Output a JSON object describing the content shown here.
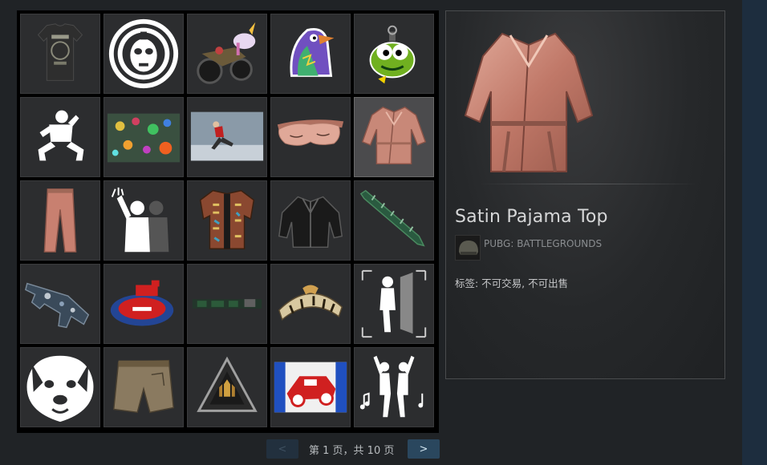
{
  "item": {
    "title": "Satin Pajama Top",
    "game": "PUBG: BATTLEGROUNDS",
    "tags_text": "标签: 不可交易, 不可出售"
  },
  "pagination": {
    "prev_label": "<",
    "next_label": ">",
    "page_text": "第 1 页，共 10 页"
  },
  "grid": {
    "selected_index": 9,
    "items": [
      {
        "icon": "tshirt-icon"
      },
      {
        "icon": "luchador-mask-icon"
      },
      {
        "icon": "unicorn-motorbike-icon"
      },
      {
        "icon": "bird-sticker-icon"
      },
      {
        "icon": "frog-grenade-icon"
      },
      {
        "icon": "squat-emote-icon"
      },
      {
        "icon": "confetti-scene-icon"
      },
      {
        "icon": "skater-scene-icon"
      },
      {
        "icon": "sleep-mask-icon"
      },
      {
        "icon": "satin-pajama-top-icon"
      },
      {
        "icon": "satin-pants-icon"
      },
      {
        "icon": "wave-emote-icon"
      },
      {
        "icon": "patterned-shirt-icon"
      },
      {
        "icon": "black-jacket-icon"
      },
      {
        "icon": "green-machete-icon"
      },
      {
        "icon": "camo-smg-icon"
      },
      {
        "icon": "red-blue-logo-icon"
      },
      {
        "icon": "faded-graffiti-icon"
      },
      {
        "icon": "tiger-hat-icon"
      },
      {
        "icon": "lean-pose-emote-icon"
      },
      {
        "icon": "dog-face-icon"
      },
      {
        "icon": "khaki-shorts-icon"
      },
      {
        "icon": "triangle-badge-icon"
      },
      {
        "icon": "race-car-sticker-icon"
      },
      {
        "icon": "dance-emote-icon"
      }
    ]
  }
}
